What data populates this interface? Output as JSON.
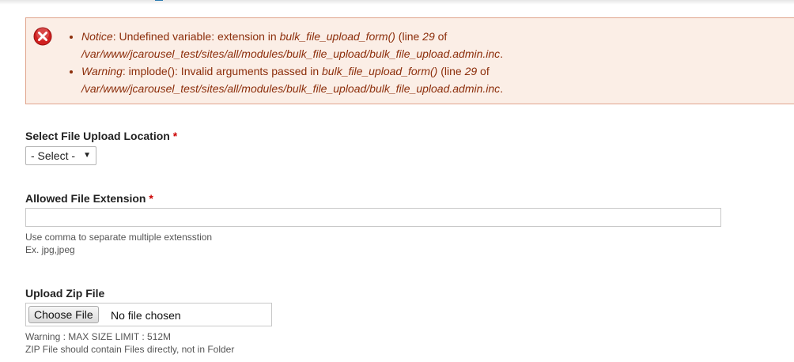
{
  "messages": [
    {
      "type": "Notice",
      "text": ": Undefined variable: extension in ",
      "function": "bulk_file_upload_form()",
      "line_pre": " (line ",
      "line": "29",
      "line_post": " of",
      "path": "/var/www/jcarousel_test/sites/all/modules/bulk_file_upload/bulk_file_upload.admin.inc",
      "end": "."
    },
    {
      "type": "Warning",
      "text": ": implode(): Invalid arguments passed in ",
      "function": "bulk_file_upload_form()",
      "line_pre": " (line ",
      "line": "29",
      "line_post": " of",
      "path": "/var/www/jcarousel_test/sites/all/modules/bulk_file_upload/bulk_file_upload.admin.inc",
      "end": "."
    }
  ],
  "form": {
    "location": {
      "label": "Select File Upload Location",
      "required_mark": "*",
      "selected": "- Select -",
      "arrow": "▼"
    },
    "extension": {
      "label": "Allowed File Extension",
      "required_mark": "*",
      "value": "",
      "help_line1": "Use comma to separate multiple extensstion",
      "help_line2": "Ex. jpg,jpeg"
    },
    "zip": {
      "label": "Upload Zip File",
      "button": "Choose File",
      "status": "No file chosen",
      "help_line1": "Warning : MAX SIZE LIMIT : 512M",
      "help_line2": "ZIP File should contain Files directly, not in Folder"
    }
  },
  "colors": {
    "error_bg": "#fbeee6",
    "error_border": "#e0a58e",
    "error_text": "#8c2e0b",
    "required": "#cc0000",
    "error_icon": "#d01f1f"
  },
  "icons": {
    "error": "error-x-icon"
  }
}
